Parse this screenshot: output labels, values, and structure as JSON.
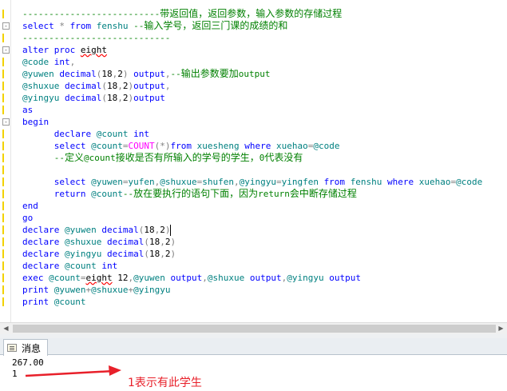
{
  "editor": {
    "lines": [
      {
        "marker": true,
        "segs": [
          {
            "c": "cm",
            "t": "--------------------------"
          },
          {
            "c": "cm cjk",
            "t": "带返回值，返回参数，输入参数的存储过程"
          }
        ]
      },
      {
        "marker": true,
        "fold": "-",
        "segs": [
          {
            "c": "kw",
            "t": "select "
          },
          {
            "c": "op",
            "t": "* "
          },
          {
            "c": "kw",
            "t": "from "
          },
          {
            "c": "id",
            "t": "fenshu "
          },
          {
            "c": "cm",
            "t": "--"
          },
          {
            "c": "cm cjk",
            "t": "输入学号，返回三门课的成绩的和"
          }
        ]
      },
      {
        "marker": true,
        "segs": [
          {
            "c": "cm",
            "t": "----------------------------"
          }
        ]
      },
      {
        "marker": true,
        "fold": "-",
        "segs": [
          {
            "c": "kw",
            "t": "alter proc "
          },
          {
            "c": "tx sq",
            "t": "eight"
          }
        ]
      },
      {
        "marker": true,
        "segs": [
          {
            "c": "id",
            "t": "@code "
          },
          {
            "c": "kw",
            "t": "int"
          },
          {
            "c": "op",
            "t": ","
          }
        ]
      },
      {
        "marker": true,
        "segs": [
          {
            "c": "id",
            "t": "@yuwen "
          },
          {
            "c": "kw",
            "t": "decimal"
          },
          {
            "c": "op",
            "t": "("
          },
          {
            "c": "tx",
            "t": "18"
          },
          {
            "c": "op",
            "t": ","
          },
          {
            "c": "tx",
            "t": "2"
          },
          {
            "c": "op",
            "t": ") "
          },
          {
            "c": "kw",
            "t": "output"
          },
          {
            "c": "op",
            "t": ","
          },
          {
            "c": "cm",
            "t": "--"
          },
          {
            "c": "cm cjk",
            "t": "输出参数要加"
          },
          {
            "c": "cm",
            "t": "output"
          }
        ]
      },
      {
        "marker": true,
        "segs": [
          {
            "c": "id",
            "t": "@shuxue "
          },
          {
            "c": "kw",
            "t": "decimal"
          },
          {
            "c": "op",
            "t": "("
          },
          {
            "c": "tx",
            "t": "18"
          },
          {
            "c": "op",
            "t": ","
          },
          {
            "c": "tx",
            "t": "2"
          },
          {
            "c": "op",
            "t": ")"
          },
          {
            "c": "kw",
            "t": "output"
          },
          {
            "c": "op",
            "t": ","
          }
        ]
      },
      {
        "marker": true,
        "segs": [
          {
            "c": "id",
            "t": "@yingyu "
          },
          {
            "c": "kw",
            "t": "decimal"
          },
          {
            "c": "op",
            "t": "("
          },
          {
            "c": "tx",
            "t": "18"
          },
          {
            "c": "op",
            "t": ","
          },
          {
            "c": "tx",
            "t": "2"
          },
          {
            "c": "op",
            "t": ")"
          },
          {
            "c": "kw",
            "t": "output"
          }
        ]
      },
      {
        "marker": true,
        "segs": [
          {
            "c": "kw",
            "t": "as"
          }
        ]
      },
      {
        "marker": true,
        "fold": "-",
        "segs": [
          {
            "c": "kw",
            "t": "begin"
          }
        ]
      },
      {
        "marker": true,
        "segs": [
          {
            "c": "tx",
            "t": "      "
          },
          {
            "c": "kw",
            "t": "declare "
          },
          {
            "c": "id",
            "t": "@count "
          },
          {
            "c": "kw",
            "t": "int"
          }
        ]
      },
      {
        "marker": true,
        "segs": [
          {
            "c": "tx",
            "t": "      "
          },
          {
            "c": "kw",
            "t": "select "
          },
          {
            "c": "id",
            "t": "@count"
          },
          {
            "c": "op",
            "t": "="
          },
          {
            "c": "fn",
            "t": "COUNT"
          },
          {
            "c": "op",
            "t": "(*)"
          },
          {
            "c": "kw",
            "t": "from "
          },
          {
            "c": "id",
            "t": "xuesheng "
          },
          {
            "c": "kw",
            "t": "where "
          },
          {
            "c": "id",
            "t": "xuehao"
          },
          {
            "c": "op",
            "t": "="
          },
          {
            "c": "id",
            "t": "@code"
          }
        ]
      },
      {
        "marker": true,
        "segs": [
          {
            "c": "tx",
            "t": "      "
          },
          {
            "c": "cm",
            "t": "--"
          },
          {
            "c": "cm cjk",
            "t": "定义"
          },
          {
            "c": "cm",
            "t": "@count"
          },
          {
            "c": "cm cjk",
            "t": "接收是否有所输入的学号的学生，"
          },
          {
            "c": "cm",
            "t": "0"
          },
          {
            "c": "cm cjk",
            "t": "代表没有"
          }
        ]
      },
      {
        "marker": true,
        "segs": []
      },
      {
        "marker": true,
        "segs": [
          {
            "c": "tx",
            "t": "      "
          },
          {
            "c": "kw",
            "t": "select "
          },
          {
            "c": "id",
            "t": "@yuwen"
          },
          {
            "c": "op",
            "t": "="
          },
          {
            "c": "id",
            "t": "yufen"
          },
          {
            "c": "op",
            "t": ","
          },
          {
            "c": "id",
            "t": "@shuxue"
          },
          {
            "c": "op",
            "t": "="
          },
          {
            "c": "id",
            "t": "shufen"
          },
          {
            "c": "op",
            "t": ","
          },
          {
            "c": "id",
            "t": "@yingyu"
          },
          {
            "c": "op",
            "t": "="
          },
          {
            "c": "id",
            "t": "yingfen "
          },
          {
            "c": "kw",
            "t": "from "
          },
          {
            "c": "id",
            "t": "fenshu "
          },
          {
            "c": "kw",
            "t": "where "
          },
          {
            "c": "id",
            "t": "xuehao"
          },
          {
            "c": "op",
            "t": "="
          },
          {
            "c": "id",
            "t": "@code"
          }
        ]
      },
      {
        "marker": true,
        "segs": [
          {
            "c": "tx",
            "t": "      "
          },
          {
            "c": "kw",
            "t": "return "
          },
          {
            "c": "id",
            "t": "@count"
          },
          {
            "c": "cm",
            "t": "--"
          },
          {
            "c": "cm cjk",
            "t": "放在要执行的语句下面，因为"
          },
          {
            "c": "cm",
            "t": "return"
          },
          {
            "c": "cm cjk",
            "t": "会中断存储过程"
          }
        ]
      },
      {
        "marker": true,
        "segs": [
          {
            "c": "kw",
            "t": "end"
          }
        ]
      },
      {
        "marker": true,
        "segs": [
          {
            "c": "kw",
            "t": "go"
          }
        ]
      },
      {
        "marker": true,
        "segs": [
          {
            "c": "kw",
            "t": "declare "
          },
          {
            "c": "id",
            "t": "@yuwen "
          },
          {
            "c": "kw",
            "t": "decimal"
          },
          {
            "c": "op",
            "t": "("
          },
          {
            "c": "tx",
            "t": "18"
          },
          {
            "c": "op",
            "t": ","
          },
          {
            "c": "tx",
            "t": "2"
          },
          {
            "c": "op",
            "t": ")"
          }
        ]
      },
      {
        "marker": true,
        "segs": [
          {
            "c": "kw",
            "t": "declare "
          },
          {
            "c": "id",
            "t": "@shuxue "
          },
          {
            "c": "kw",
            "t": "decimal"
          },
          {
            "c": "op",
            "t": "("
          },
          {
            "c": "tx",
            "t": "18"
          },
          {
            "c": "op",
            "t": ","
          },
          {
            "c": "tx",
            "t": "2"
          },
          {
            "c": "op",
            "t": ")"
          }
        ]
      },
      {
        "marker": true,
        "segs": [
          {
            "c": "kw",
            "t": "declare "
          },
          {
            "c": "id",
            "t": "@yingyu "
          },
          {
            "c": "kw",
            "t": "decimal"
          },
          {
            "c": "op",
            "t": "("
          },
          {
            "c": "tx",
            "t": "18"
          },
          {
            "c": "op",
            "t": ","
          },
          {
            "c": "tx",
            "t": "2"
          },
          {
            "c": "op",
            "t": ")"
          }
        ]
      },
      {
        "marker": true,
        "segs": [
          {
            "c": "kw",
            "t": "declare "
          },
          {
            "c": "id",
            "t": "@count "
          },
          {
            "c": "kw",
            "t": "int"
          }
        ]
      },
      {
        "marker": true,
        "segs": [
          {
            "c": "kw",
            "t": "exec "
          },
          {
            "c": "id",
            "t": "@count"
          },
          {
            "c": "op",
            "t": "="
          },
          {
            "c": "tx sq",
            "t": "eight"
          },
          {
            "c": "tx",
            "t": " 12"
          },
          {
            "c": "op",
            "t": ","
          },
          {
            "c": "id",
            "t": "@yuwen "
          },
          {
            "c": "kw",
            "t": "output"
          },
          {
            "c": "op",
            "t": ","
          },
          {
            "c": "id",
            "t": "@shuxue "
          },
          {
            "c": "kw",
            "t": "output"
          },
          {
            "c": "op",
            "t": ","
          },
          {
            "c": "id",
            "t": "@yingyu "
          },
          {
            "c": "kw",
            "t": "output"
          }
        ]
      },
      {
        "marker": true,
        "segs": [
          {
            "c": "kw",
            "t": "print "
          },
          {
            "c": "id",
            "t": "@yuwen"
          },
          {
            "c": "op",
            "t": "+"
          },
          {
            "c": "id",
            "t": "@shuxue"
          },
          {
            "c": "op",
            "t": "+"
          },
          {
            "c": "id",
            "t": "@yingyu"
          }
        ]
      },
      {
        "marker": true,
        "segs": [
          {
            "c": "kw",
            "t": "print "
          },
          {
            "c": "id",
            "t": "@count"
          }
        ]
      }
    ]
  },
  "scrollbar": {
    "left_arrow": "◀",
    "right_arrow": "▶"
  },
  "results_tab": {
    "label": "消息",
    "icon": "message-icon"
  },
  "results": {
    "line1": "267.00",
    "line2": "1"
  },
  "annotation": {
    "text": "1表示有此学生",
    "color": "#e8202a"
  }
}
